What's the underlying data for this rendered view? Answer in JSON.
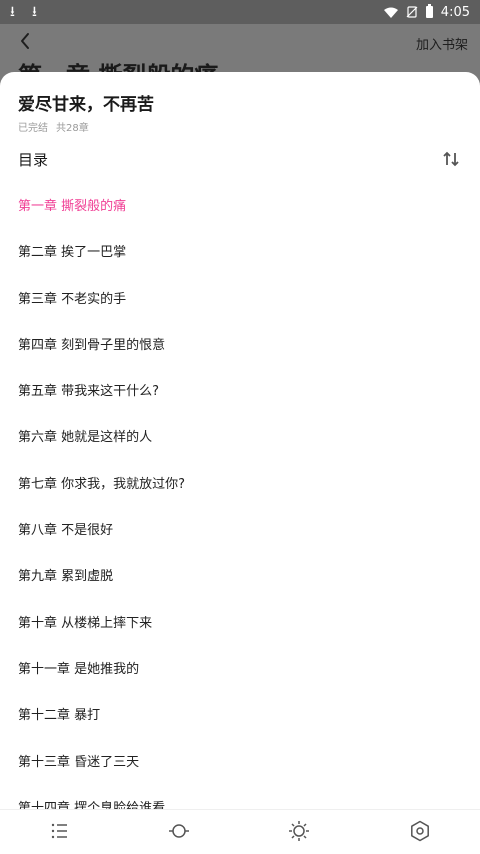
{
  "status": {
    "time": "4:05"
  },
  "background": {
    "shelf_label": "加入书架",
    "chapter_title": "第一章 撕裂般的痛"
  },
  "book": {
    "title": "爱尽甘来，不再苦",
    "status": "已完结",
    "count": "共28章"
  },
  "toc": {
    "title": "目录",
    "active_index": 0,
    "chapters": [
      "第一章 撕裂般的痛",
      "第二章 挨了一巴掌",
      "第三章 不老实的手",
      "第四章 刻到骨子里的恨意",
      "第五章 带我来这干什么?",
      "第六章 她就是这样的人",
      "第七章 你求我，我就放过你?",
      "第八章 不是很好",
      "第九章 累到虚脱",
      "第十章 从楼梯上摔下来",
      "第十一章 是她推我的",
      "第十二章 暴打",
      "第十三章 昏迷了三天",
      "第十四章 摆个臭脸给谁看"
    ]
  },
  "toolbar": [
    "list-icon",
    "progress-icon",
    "brightness-icon",
    "settings-icon"
  ],
  "colors": {
    "accent": "#f03f95",
    "overlay": "#7a7a7a",
    "text": "#222222",
    "meta": "#9a9a9a"
  }
}
